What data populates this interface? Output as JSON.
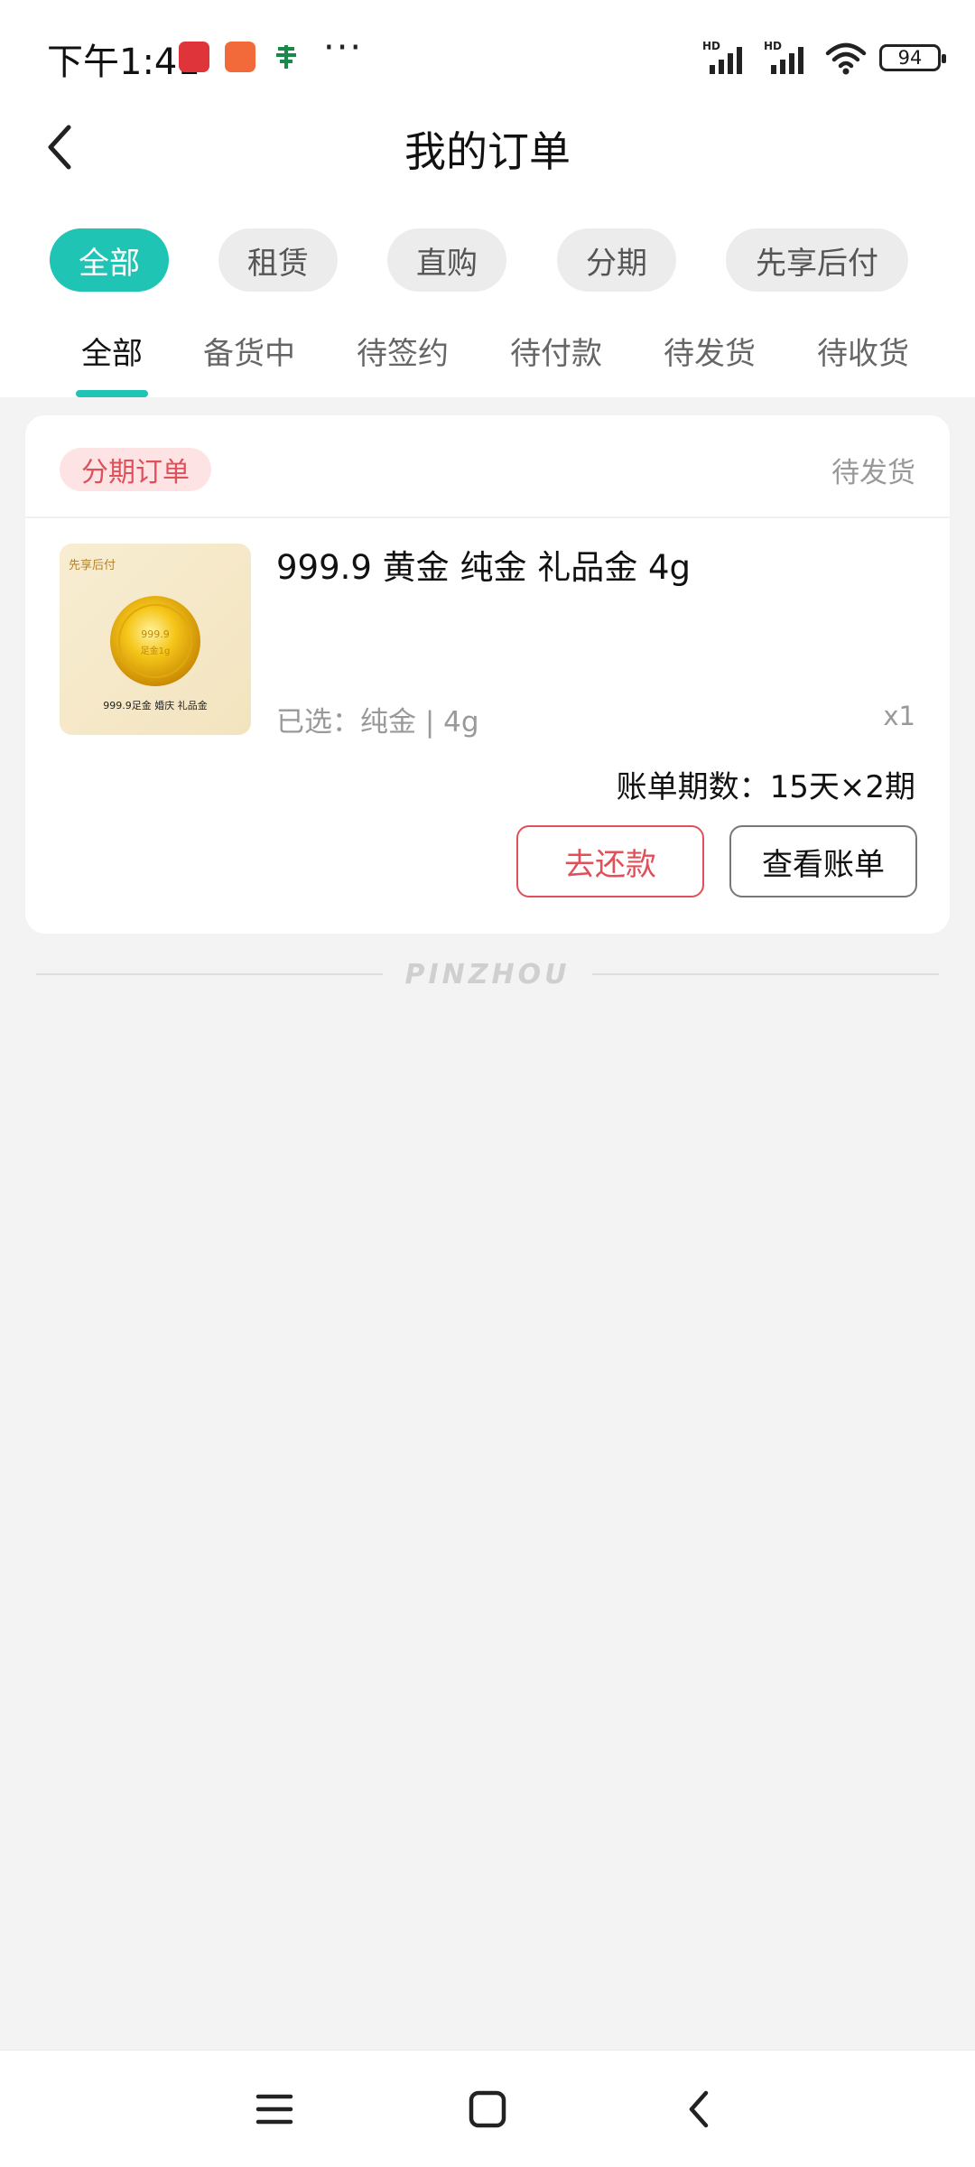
{
  "status_bar": {
    "time": "下午1:41",
    "battery": "94",
    "signal_label_1": "HD",
    "signal_label_2": "HD",
    "more": "···"
  },
  "header": {
    "title": "我的订单",
    "back_icon": "chevron-left-icon"
  },
  "filter_chips": [
    {
      "label": "全部",
      "active": true
    },
    {
      "label": "租赁",
      "active": false
    },
    {
      "label": "直购",
      "active": false
    },
    {
      "label": "分期",
      "active": false
    },
    {
      "label": "先享后付",
      "active": false
    }
  ],
  "status_tabs": [
    {
      "label": "全部",
      "active": true
    },
    {
      "label": "备货中",
      "active": false
    },
    {
      "label": "待签约",
      "active": false
    },
    {
      "label": "待付款",
      "active": false
    },
    {
      "label": "待发货",
      "active": false
    },
    {
      "label": "待收货",
      "active": false
    }
  ],
  "order": {
    "type_tag": "分期订单",
    "status": "待发货",
    "product_name": "999.9 黄金 纯金 礼品金 4g",
    "spec": "已选：纯金 | 4g",
    "quantity": "x1",
    "installments": "账单期数：15天×2期",
    "image_caption": "999.9足金 婚庆 礼品金",
    "image_badge": "先享后付",
    "coin_text_top": "999.9",
    "coin_text_bottom": "足金1g",
    "repay_button": "去还款",
    "view_bill_button": "查看账单"
  },
  "footer": {
    "brand": "PINZHOU"
  },
  "nav_bar": {
    "menu_icon": "menu-icon",
    "home_icon": "home-square-icon",
    "back_icon": "back-triangle-icon"
  },
  "colors": {
    "accent": "#1fc4b4",
    "danger": "#e0505a",
    "tag_bg": "#fde3e3",
    "page_bg": "#f3f3f3"
  }
}
